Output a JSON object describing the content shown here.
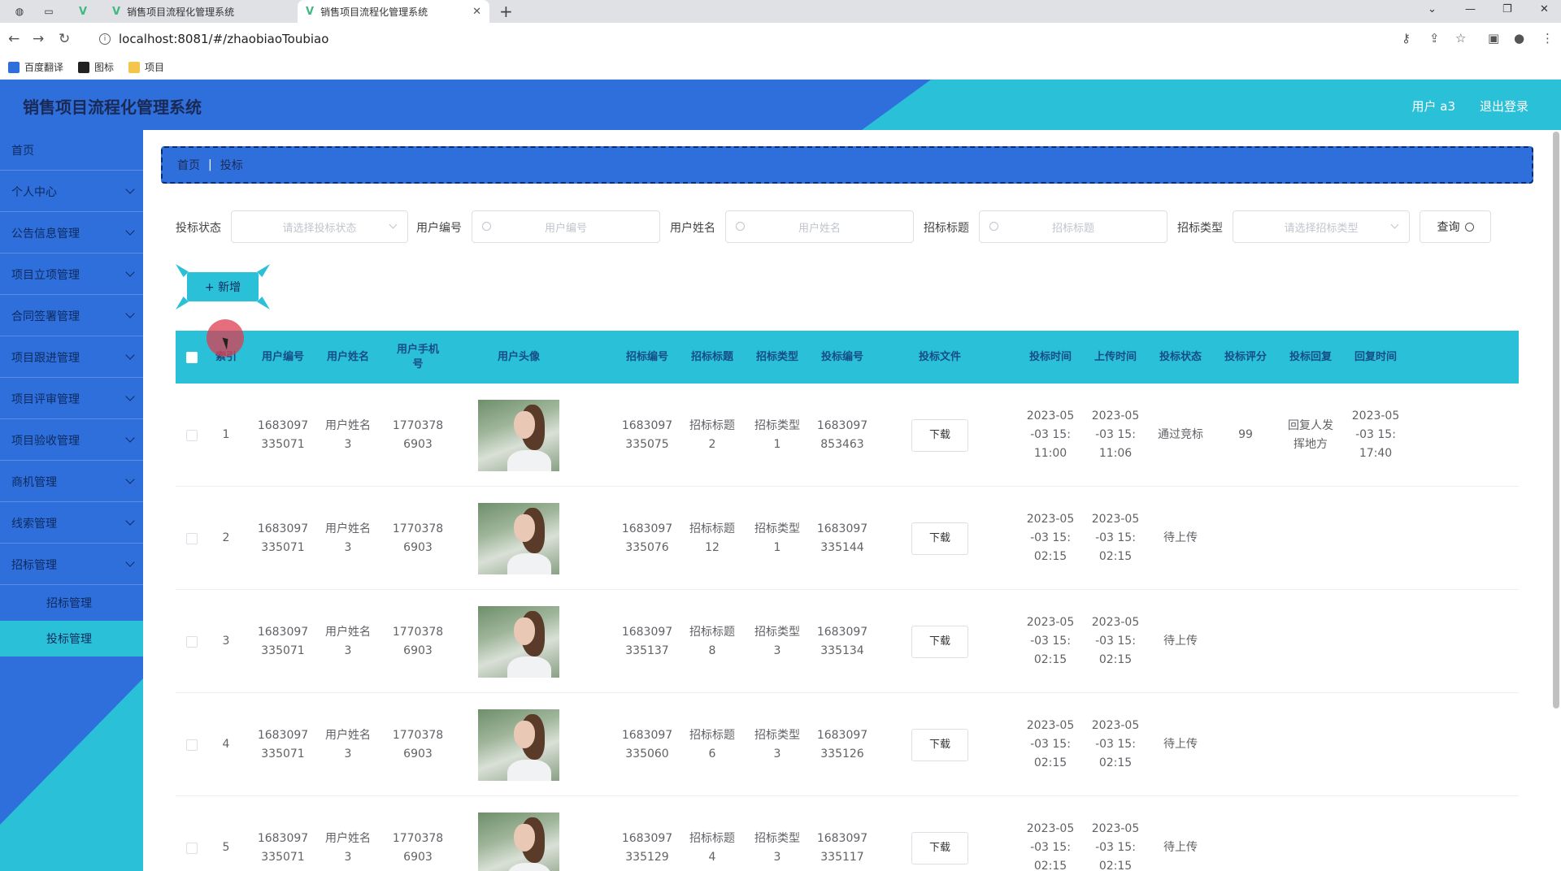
{
  "browser": {
    "tabs": [
      {
        "label": "销售项目流程化管理系统"
      },
      {
        "label": "销售项目流程化管理系统"
      }
    ],
    "url": "localhost:8081/#/zhaobiaoToubiao",
    "bookmarks": [
      {
        "label": "百度翻译"
      },
      {
        "label": "图标"
      },
      {
        "label": "项目"
      }
    ]
  },
  "header": {
    "title": "销售项目流程化管理系统",
    "user": "用户 a3",
    "logout": "退出登录"
  },
  "sidebar": {
    "items": [
      {
        "label": "首页"
      },
      {
        "label": "个人中心"
      },
      {
        "label": "公告信息管理"
      },
      {
        "label": "项目立项管理"
      },
      {
        "label": "合同签署管理"
      },
      {
        "label": "项目跟进管理"
      },
      {
        "label": "项目评审管理"
      },
      {
        "label": "项目验收管理"
      },
      {
        "label": "商机管理"
      },
      {
        "label": "线索管理"
      },
      {
        "label": "招标管理"
      }
    ],
    "subitems": [
      {
        "label": "招标管理"
      },
      {
        "label": "投标管理"
      }
    ]
  },
  "breadcrumb": {
    "home": "首页",
    "current": "投标"
  },
  "search": {
    "status_label": "投标状态",
    "status_placeholder": "请选择投标状态",
    "user_no_label": "用户编号",
    "user_no_placeholder": "用户编号",
    "user_name_label": "用户姓名",
    "user_name_placeholder": "用户姓名",
    "bid_title_label": "招标标题",
    "bid_title_placeholder": "招标标题",
    "bid_type_label": "招标类型",
    "bid_type_placeholder": "请选择招标类型",
    "query": "查询"
  },
  "add_button": "+ 新增",
  "table": {
    "headers": [
      "索引",
      "用户编号",
      "用户姓名",
      "用户手机号",
      "用户头像",
      "招标编号",
      "招标标题",
      "招标类型",
      "投标编号",
      "投标文件",
      "投标时间",
      "上传时间",
      "投标状态",
      "投标评分",
      "投标回复",
      "回复时间"
    ],
    "download_label": "下载",
    "rows": [
      {
        "idx": "1",
        "user_no": "1683097335071",
        "user_name": "用户姓名3",
        "phone": "17703786903",
        "bid_no": "1683097335075",
        "bid_title": "招标标题2",
        "bid_type": "招标类型1",
        "tender_no": "1683097853463",
        "tender_time": "2023-05-03 15:11:00",
        "upload_time": "2023-05-03 15:11:06",
        "status": "通过竞标",
        "score": "99",
        "reply": "回复人发挥地方",
        "reply_time": "2023-05-03 15:17:40"
      },
      {
        "idx": "2",
        "user_no": "1683097335071",
        "user_name": "用户姓名3",
        "phone": "17703786903",
        "bid_no": "1683097335076",
        "bid_title": "招标标题12",
        "bid_type": "招标类型1",
        "tender_no": "1683097335144",
        "tender_time": "2023-05-03 15:02:15",
        "upload_time": "2023-05-03 15:02:15",
        "status": "待上传",
        "score": "",
        "reply": "",
        "reply_time": ""
      },
      {
        "idx": "3",
        "user_no": "1683097335071",
        "user_name": "用户姓名3",
        "phone": "17703786903",
        "bid_no": "1683097335137",
        "bid_title": "招标标题8",
        "bid_type": "招标类型3",
        "tender_no": "1683097335134",
        "tender_time": "2023-05-03 15:02:15",
        "upload_time": "2023-05-03 15:02:15",
        "status": "待上传",
        "score": "",
        "reply": "",
        "reply_time": ""
      },
      {
        "idx": "4",
        "user_no": "1683097335071",
        "user_name": "用户姓名3",
        "phone": "17703786903",
        "bid_no": "1683097335060",
        "bid_title": "招标标题6",
        "bid_type": "招标类型3",
        "tender_no": "1683097335126",
        "tender_time": "2023-05-03 15:02:15",
        "upload_time": "2023-05-03 15:02:15",
        "status": "待上传",
        "score": "",
        "reply": "",
        "reply_time": ""
      },
      {
        "idx": "5",
        "user_no": "1683097335071",
        "user_name": "用户姓名3",
        "phone": "17703786903",
        "bid_no": "1683097335129",
        "bid_title": "招标标题4",
        "bid_type": "招标类型3",
        "tender_no": "1683097335117",
        "tender_time": "2023-05-03 15:02:15",
        "upload_time": "2023-05-03 15:02:15",
        "status": "待上传",
        "score": "",
        "reply": "",
        "reply_time": ""
      }
    ]
  }
}
